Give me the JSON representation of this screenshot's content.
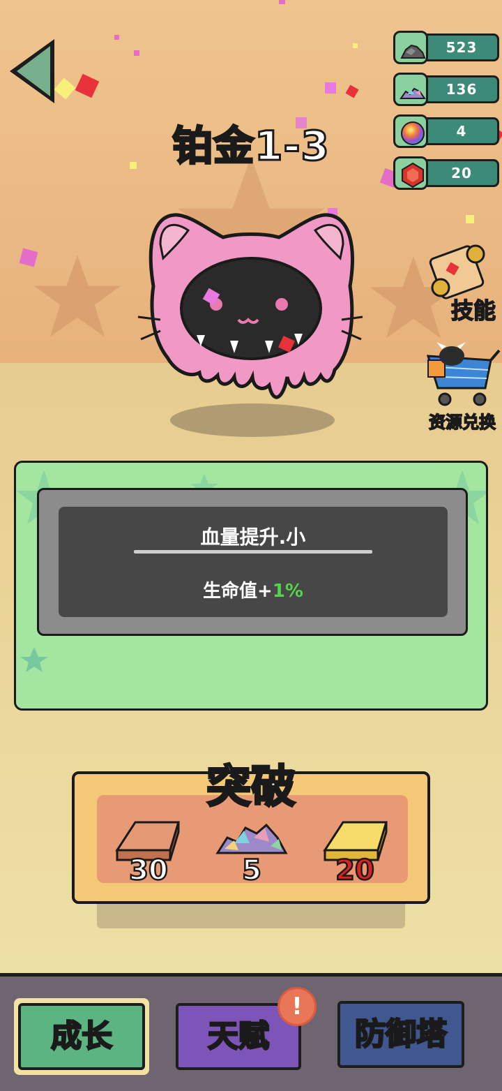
{
  "resources": [
    {
      "name": "grey-ore-icon",
      "value": "523"
    },
    {
      "name": "crystal-pile-icon",
      "value": "136"
    },
    {
      "name": "rainbow-orb-icon",
      "value": "4"
    },
    {
      "name": "red-gem-icon",
      "value": "20"
    }
  ],
  "level": {
    "title": "铂金1-3"
  },
  "side_buttons": {
    "skill_label": "技能",
    "exchange_label": "资源兑换"
  },
  "upgrade_card": {
    "name": "血量提升.小",
    "desc_prefix": "生命值+",
    "desc_value": "1%"
  },
  "breakthrough": {
    "title": "突破",
    "materials": [
      {
        "icon": "copper-ingot-icon",
        "count": "30",
        "sufficient": true
      },
      {
        "icon": "crystal-pile-icon",
        "count": "5",
        "sufficient": true
      },
      {
        "icon": "gold-ingot-icon",
        "count": "20",
        "sufficient": false
      }
    ]
  },
  "nav": {
    "growth": "成长",
    "talent": "天赋",
    "tower": "防御塔",
    "talent_badge": "!"
  },
  "colors": {
    "accent_green": "#53d44b",
    "insufficient_red": "#d92222",
    "nav_growth": "#5cb482",
    "nav_talent": "#7d54b8",
    "nav_tower": "#41578f"
  }
}
